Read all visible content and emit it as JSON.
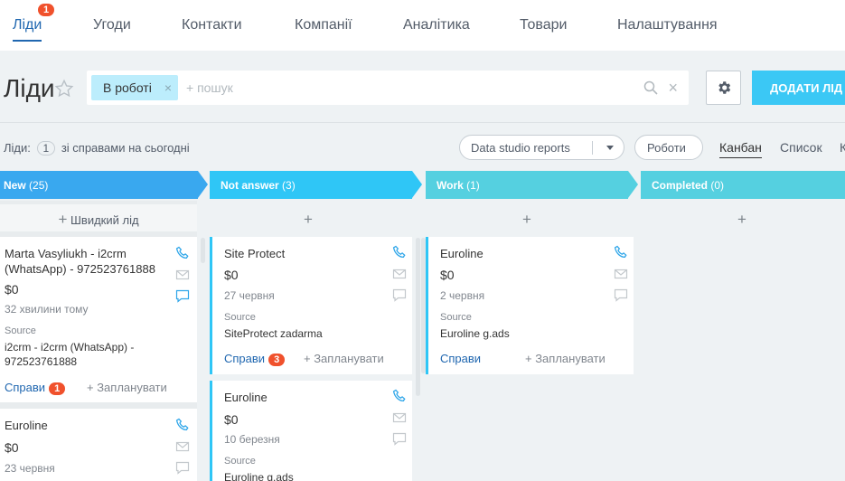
{
  "nav": {
    "items": [
      "Ліди",
      "Угоди",
      "Контакти",
      "Компанії",
      "Аналітика",
      "Товари",
      "Налаштування"
    ],
    "badge": "1"
  },
  "header": {
    "title": "Ліди",
    "filter_chip": "В роботі",
    "chip_close": "×",
    "search_placeholder": "+ пошук",
    "clear": "×",
    "add_button": "ДОДАТИ ЛІД"
  },
  "toolbar": {
    "leads_prefix": "Ліди:",
    "leads_count": "1",
    "leads_suffix": "зі справами на сьогодні",
    "report_button": "Data studio reports",
    "robots_button": "Роботи",
    "views": [
      "Канбан",
      "Список",
      "К"
    ]
  },
  "stages": [
    {
      "name": "New",
      "count": "(25)",
      "color": "#39a8ef"
    },
    {
      "name": "Not answer",
      "count": "(3)",
      "color": "#2fc6f6"
    },
    {
      "name": "Work",
      "count": "(1)",
      "color": "#55d0e0"
    },
    {
      "name": "Completed",
      "count": "(0)",
      "color": "#55d0e0"
    }
  ],
  "quick_add": {
    "label": "Швидкий лід",
    "plus": "+"
  },
  "cards": {
    "c1": {
      "title": "Marta Vasyliukh - i2crm (WhatsApp) - 972523761888",
      "sum": "$0",
      "date": "32 хвилини тому",
      "src_label": "Source",
      "src": "i2crm - i2crm (WhatsApp) - 972523761888",
      "actions": "Справи",
      "badge": "1",
      "plan": "+ Запланувати"
    },
    "c2": {
      "title": "Euroline",
      "sum": "$0",
      "date": "23 червня"
    },
    "c3": {
      "title": "Site Protect",
      "sum": "$0",
      "date": "27 червня",
      "src_label": "Source",
      "src": "SiteProtect zadarma",
      "actions": "Справи",
      "badge": "3",
      "plan": "+ Запланувати"
    },
    "c4": {
      "title": "Euroline",
      "sum": "$0",
      "date": "10 березня",
      "src_label": "Source",
      "src": "Euroline g.ads"
    },
    "c5": {
      "title": "Euroline",
      "sum": "$0",
      "date": "2 червня",
      "src_label": "Source",
      "src": "Euroline g.ads",
      "actions": "Справи",
      "plan": "+ Запланувати"
    }
  },
  "colors": {
    "accent": "#2067b0",
    "badge": "#f0512c",
    "add_button": "#3bc8f5"
  },
  "icons": [
    "star-icon",
    "search-icon",
    "gear-icon",
    "phone-icon",
    "mail-icon",
    "chat-icon"
  ]
}
